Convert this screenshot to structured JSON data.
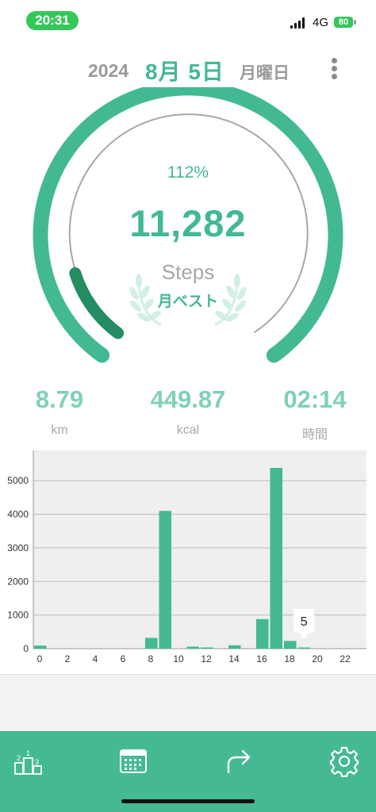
{
  "status": {
    "time": "20:31",
    "network": "4G",
    "battery": "80"
  },
  "header": {
    "year": "2024",
    "month_day": "8月 5日",
    "weekday": "月曜日",
    "menu_icon": "more-vertical-icon"
  },
  "summary": {
    "percent": "112%",
    "percent_value": 112,
    "steps": "11,282",
    "steps_label": "Steps",
    "badge": "月ベスト"
  },
  "stats": [
    {
      "value": "8.79",
      "unit": "km"
    },
    {
      "value": "449.87",
      "unit": "kcal"
    },
    {
      "value": "02:14",
      "unit": "時間"
    }
  ],
  "chart_data": {
    "type": "bar",
    "x": [
      0,
      1,
      2,
      3,
      4,
      5,
      6,
      7,
      8,
      9,
      10,
      11,
      12,
      13,
      14,
      15,
      16,
      17,
      18,
      19,
      20,
      21,
      22,
      23
    ],
    "values": [
      90,
      0,
      0,
      0,
      0,
      0,
      0,
      0,
      320,
      4100,
      0,
      60,
      20,
      0,
      100,
      0,
      880,
      5380,
      230,
      5,
      0,
      0,
      0,
      0
    ],
    "xticks": [
      "0",
      "2",
      "4",
      "6",
      "8",
      "10",
      "12",
      "14",
      "16",
      "18",
      "20",
      "22"
    ],
    "yticks": [
      "0",
      "1000",
      "2000",
      "3000",
      "4000",
      "5000"
    ],
    "ylim": [
      0,
      5900
    ],
    "tooltip": {
      "hour": 19,
      "value": "5"
    },
    "bar_color": "#44b994",
    "grid": true
  },
  "tabbar": {
    "items": [
      "ranking-icon",
      "calendar-icon",
      "share-icon",
      "gear-icon"
    ]
  },
  "colors": {
    "accent": "#42b993",
    "dark_accent": "#248c62",
    "ring_gray": "#a8a8a8"
  }
}
